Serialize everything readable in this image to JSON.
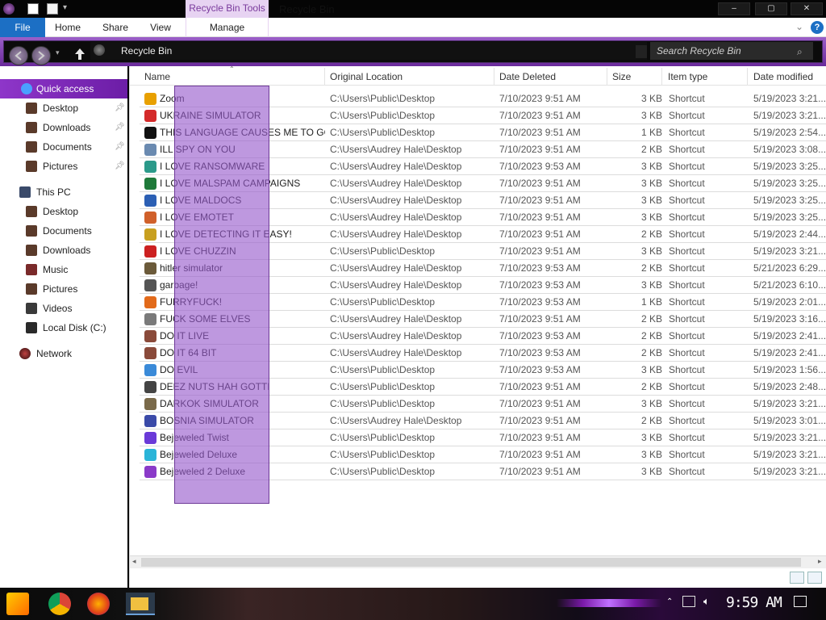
{
  "window": {
    "title": "Recycle Bin",
    "contextual_tab_group": "Recycle Bin Tools",
    "controls": {
      "minimize": "–",
      "maximize": "▢",
      "close": "✕"
    }
  },
  "ribbon": {
    "tabs": [
      "File",
      "Home",
      "Share",
      "View",
      "Manage"
    ],
    "help_icon": "?"
  },
  "address": {
    "breadcrumb": "Recycle Bin",
    "search_placeholder": "Search Recycle Bin"
  },
  "sidebar": {
    "quick_access": "Quick access",
    "quick_items": [
      "Desktop",
      "Downloads",
      "Documents",
      "Pictures"
    ],
    "this_pc": "This PC",
    "pc_items": [
      "Desktop",
      "Documents",
      "Downloads",
      "Music",
      "Pictures",
      "Videos",
      "Local Disk (C:)"
    ],
    "network": "Network"
  },
  "columns": [
    "Name",
    "Original Location",
    "Date Deleted",
    "Size",
    "Item type",
    "Date modified"
  ],
  "files": [
    {
      "name": "Zoom",
      "location": "C:\\Users\\Public\\Desktop",
      "deleted": "7/10/2023 9:51 AM",
      "size": "3 KB",
      "type": "Shortcut",
      "modified": "5/19/2023 3:21...",
      "icon_color": "#e8a000"
    },
    {
      "name": "UKRAINE SIMULATOR",
      "location": "C:\\Users\\Public\\Desktop",
      "deleted": "7/10/2023 9:51 AM",
      "size": "3 KB",
      "type": "Shortcut",
      "modified": "5/19/2023 3:21...",
      "icon_color": "#d42a2a"
    },
    {
      "name": "THIS LANGUAGE CAUSES ME TO GO IN...",
      "location": "C:\\Users\\Public\\Desktop",
      "deleted": "7/10/2023 9:51 AM",
      "size": "1 KB",
      "type": "Shortcut",
      "modified": "5/19/2023 2:54...",
      "icon_color": "#111111"
    },
    {
      "name": "ILL SPY ON YOU",
      "location": "C:\\Users\\Audrey Hale\\Desktop",
      "deleted": "7/10/2023 9:51 AM",
      "size": "2 KB",
      "type": "Shortcut",
      "modified": "5/19/2023 3:08...",
      "icon_color": "#6a8ab0"
    },
    {
      "name": "I LOVE RANSOMWARE",
      "location": "C:\\Users\\Audrey Hale\\Desktop",
      "deleted": "7/10/2023 9:53 AM",
      "size": "3 KB",
      "type": "Shortcut",
      "modified": "5/19/2023 3:25...",
      "icon_color": "#2b9a8a"
    },
    {
      "name": "I LOVE MALSPAM CAMPAIGNS",
      "location": "C:\\Users\\Audrey Hale\\Desktop",
      "deleted": "7/10/2023 9:51 AM",
      "size": "3 KB",
      "type": "Shortcut",
      "modified": "5/19/2023 3:25...",
      "icon_color": "#1f7a3a"
    },
    {
      "name": "I LOVE MALDOCS",
      "location": "C:\\Users\\Audrey Hale\\Desktop",
      "deleted": "7/10/2023 9:51 AM",
      "size": "3 KB",
      "type": "Shortcut",
      "modified": "5/19/2023 3:25...",
      "icon_color": "#2b5fb4"
    },
    {
      "name": "I LOVE EMOTET",
      "location": "C:\\Users\\Audrey Hale\\Desktop",
      "deleted": "7/10/2023 9:51 AM",
      "size": "3 KB",
      "type": "Shortcut",
      "modified": "5/19/2023 3:25...",
      "icon_color": "#d0602a"
    },
    {
      "name": "I LOVE DETECTING IT EASY!",
      "location": "C:\\Users\\Audrey Hale\\Desktop",
      "deleted": "7/10/2023 9:51 AM",
      "size": "2 KB",
      "type": "Shortcut",
      "modified": "5/19/2023 2:44...",
      "icon_color": "#c8a020"
    },
    {
      "name": "I LOVE CHUZZIN",
      "location": "C:\\Users\\Public\\Desktop",
      "deleted": "7/10/2023 9:51 AM",
      "size": "3 KB",
      "type": "Shortcut",
      "modified": "5/19/2023 3:21...",
      "icon_color": "#cc2020"
    },
    {
      "name": "hitler simulator",
      "location": "C:\\Users\\Audrey Hale\\Desktop",
      "deleted": "7/10/2023 9:53 AM",
      "size": "2 KB",
      "type": "Shortcut",
      "modified": "5/21/2023 6:29...",
      "icon_color": "#6b5a3a"
    },
    {
      "name": "garbage!",
      "location": "C:\\Users\\Audrey Hale\\Desktop",
      "deleted": "7/10/2023 9:53 AM",
      "size": "3 KB",
      "type": "Shortcut",
      "modified": "5/21/2023 6:10...",
      "icon_color": "#555555"
    },
    {
      "name": "FURRYFUCK!",
      "location": "C:\\Users\\Public\\Desktop",
      "deleted": "7/10/2023 9:53 AM",
      "size": "1 KB",
      "type": "Shortcut",
      "modified": "5/19/2023 2:01...",
      "icon_color": "#e26a1a"
    },
    {
      "name": "FUCK SOME ELVES",
      "location": "C:\\Users\\Audrey Hale\\Desktop",
      "deleted": "7/10/2023 9:51 AM",
      "size": "2 KB",
      "type": "Shortcut",
      "modified": "5/19/2023 3:16...",
      "icon_color": "#7a7a7a"
    },
    {
      "name": "DO IT LIVE",
      "location": "C:\\Users\\Audrey Hale\\Desktop",
      "deleted": "7/10/2023 9:53 AM",
      "size": "2 KB",
      "type": "Shortcut",
      "modified": "5/19/2023 2:41...",
      "icon_color": "#8a4a3a"
    },
    {
      "name": "DO IT 64 BIT",
      "location": "C:\\Users\\Audrey Hale\\Desktop",
      "deleted": "7/10/2023 9:53 AM",
      "size": "2 KB",
      "type": "Shortcut",
      "modified": "5/19/2023 2:41...",
      "icon_color": "#8a4a3a"
    },
    {
      "name": "DO EVIL",
      "location": "C:\\Users\\Public\\Desktop",
      "deleted": "7/10/2023 9:53 AM",
      "size": "3 KB",
      "type": "Shortcut",
      "modified": "5/19/2023 1:56...",
      "icon_color": "#3a8ad8"
    },
    {
      "name": "DEEZ NUTS HAH GOTTI",
      "location": "C:\\Users\\Public\\Desktop",
      "deleted": "7/10/2023 9:51 AM",
      "size": "2 KB",
      "type": "Shortcut",
      "modified": "5/19/2023 2:48...",
      "icon_color": "#444444"
    },
    {
      "name": "DARKOK SIMULATOR",
      "location": "C:\\Users\\Public\\Desktop",
      "deleted": "7/10/2023 9:51 AM",
      "size": "3 KB",
      "type": "Shortcut",
      "modified": "5/19/2023 3:21...",
      "icon_color": "#7a6a4a"
    },
    {
      "name": "BOSNIA SIMULATOR",
      "location": "C:\\Users\\Audrey Hale\\Desktop",
      "deleted": "7/10/2023 9:51 AM",
      "size": "2 KB",
      "type": "Shortcut",
      "modified": "5/19/2023 3:01...",
      "icon_color": "#3a4aa8"
    },
    {
      "name": "Bejeweled Twist",
      "location": "C:\\Users\\Public\\Desktop",
      "deleted": "7/10/2023 9:51 AM",
      "size": "3 KB",
      "type": "Shortcut",
      "modified": "5/19/2023 3:21...",
      "icon_color": "#6a3ad8"
    },
    {
      "name": "Bejeweled Deluxe",
      "location": "C:\\Users\\Public\\Desktop",
      "deleted": "7/10/2023 9:51 AM",
      "size": "3 KB",
      "type": "Shortcut",
      "modified": "5/19/2023 3:21...",
      "icon_color": "#2ab4d8"
    },
    {
      "name": "Bejeweled 2 Deluxe",
      "location": "C:\\Users\\Public\\Desktop",
      "deleted": "7/10/2023 9:51 AM",
      "size": "3 KB",
      "type": "Shortcut",
      "modified": "5/19/2023 3:21...",
      "icon_color": "#8a3ac8"
    }
  ],
  "taskbar": {
    "clock": "9:59 AM"
  },
  "colors": {
    "accent_purple": "#8e36c9",
    "selection_fill": "#9658cc",
    "file_tab_blue": "#1c6fc4"
  }
}
